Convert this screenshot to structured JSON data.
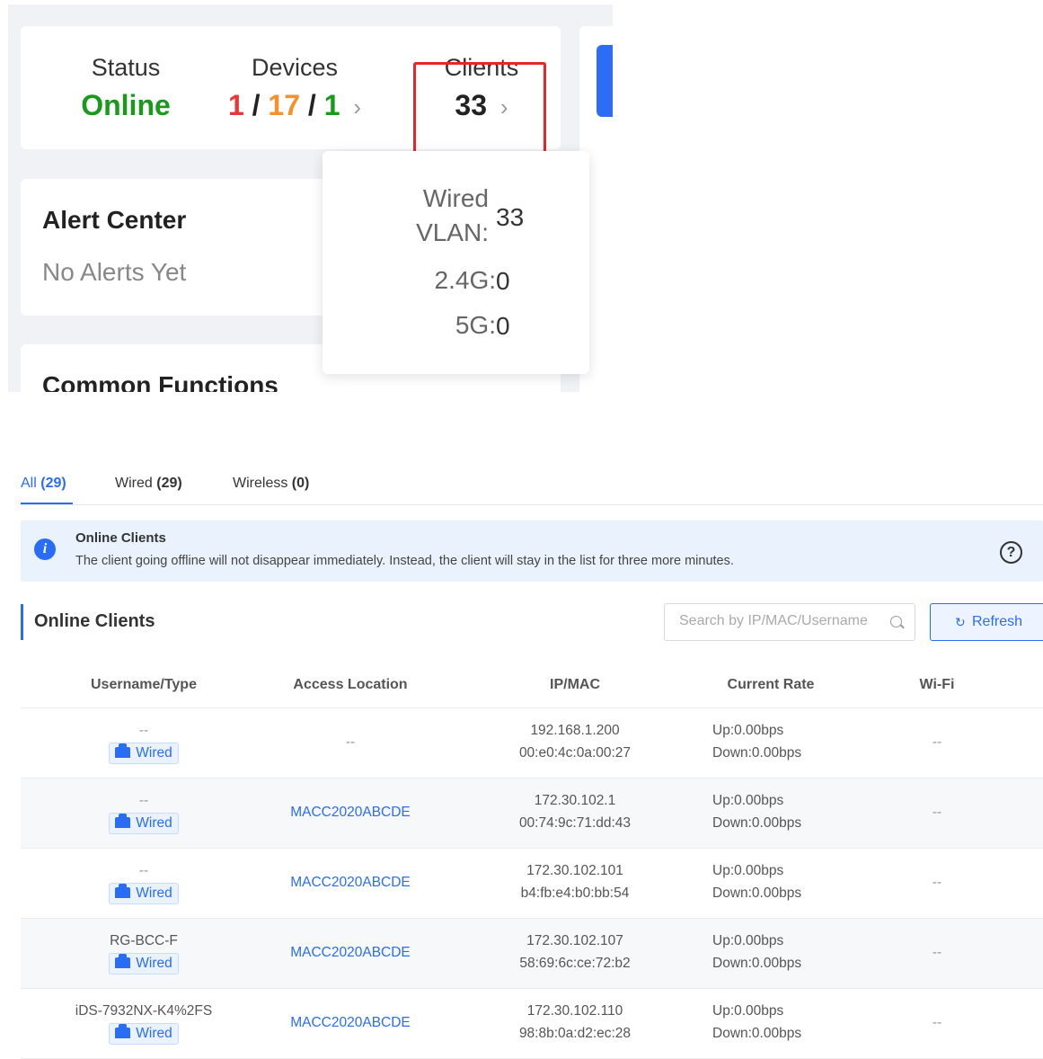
{
  "dashboard": {
    "status": {
      "label": "Status",
      "value": "Online"
    },
    "devices": {
      "label": "Devices",
      "a": "1",
      "sep1": "/",
      "b": "17",
      "sep2": "/",
      "c": "1",
      "chevron": "›"
    },
    "clients": {
      "label": "Clients",
      "value": "33",
      "chevron": "›"
    },
    "alert_center": {
      "title": "Alert Center",
      "subtitle": "No Alerts Yet"
    },
    "common_functions": {
      "title": "Common Functions"
    },
    "popover": {
      "wired_label_line1": "Wired",
      "wired_label_line2": "VLAN:",
      "wired_value": "33",
      "g24_label": "2.4G:",
      "g24_value": "0",
      "g5_label": "5G:",
      "g5_value": "0"
    }
  },
  "tabs": [
    {
      "label": "All",
      "count": "(29)"
    },
    {
      "label": "Wired",
      "count": "(29)"
    },
    {
      "label": "Wireless",
      "count": "(0)"
    }
  ],
  "info": {
    "icon": "info-icon",
    "title": "Online Clients",
    "text": "The client going offline will not disappear immediately. Instead, the client will stay in the list for three more minutes.",
    "help": "?"
  },
  "section": {
    "title": "Online Clients",
    "search_placeholder": "Search by IP/MAC/Username",
    "refresh_icon": "↻",
    "refresh_label": "Refresh"
  },
  "table": {
    "headers": [
      "Username/Type",
      "Access Location",
      "IP/MAC",
      "Current Rate",
      "Wi-Fi"
    ],
    "rows": [
      {
        "username": "--",
        "type": "Wired",
        "location": "--",
        "ip": "192.168.1.200",
        "mac": "00:e0:4c:0a:00:27",
        "up": "Up:0.00bps",
        "down": "Down:0.00bps",
        "wifi": "--"
      },
      {
        "username": "--",
        "type": "Wired",
        "location": "MACC2020ABCDE",
        "ip": "172.30.102.1",
        "mac": "00:74:9c:71:dd:43",
        "up": "Up:0.00bps",
        "down": "Down:0.00bps",
        "wifi": "--"
      },
      {
        "username": "--",
        "type": "Wired",
        "location": "MACC2020ABCDE",
        "ip": "172.30.102.101",
        "mac": "b4:fb:e4:b0:bb:54",
        "up": "Up:0.00bps",
        "down": "Down:0.00bps",
        "wifi": "--"
      },
      {
        "username": "RG-BCC-F",
        "type": "Wired",
        "location": "MACC2020ABCDE",
        "ip": "172.30.102.107",
        "mac": "58:69:6c:ce:72:b2",
        "up": "Up:0.00bps",
        "down": "Down:0.00bps",
        "wifi": "--"
      },
      {
        "username": "iDS-7932NX-K4%2FS",
        "type": "Wired",
        "location": "MACC2020ABCDE",
        "ip": "172.30.102.110",
        "mac": "98:8b:0a:d2:ec:28",
        "up": "Up:0.00bps",
        "down": "Down:0.00bps",
        "wifi": "--"
      }
    ]
  }
}
